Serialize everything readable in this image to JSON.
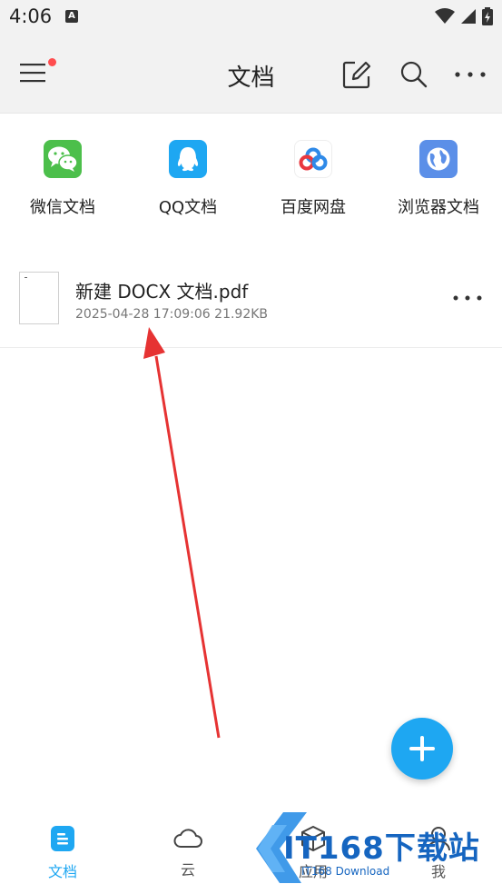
{
  "status_bar": {
    "time": "4:06",
    "a_badge": "A"
  },
  "app_bar": {
    "title": "文档"
  },
  "sources": [
    {
      "label": "微信文档",
      "icon": "wechat-icon",
      "color": "#4cbf4b"
    },
    {
      "label": "QQ文档",
      "icon": "qq-icon",
      "color": "#1ea7f2"
    },
    {
      "label": "百度网盘",
      "icon": "baidu-netdisk-icon",
      "color": "#ffffff"
    },
    {
      "label": "浏览器文档",
      "icon": "browser-icon",
      "color": "#5b8fe8"
    }
  ],
  "files": [
    {
      "name": "新建 DOCX 文档.pdf",
      "date": "2025-04-28 17:09:06",
      "size": "21.92KB"
    }
  ],
  "bottom_nav": [
    {
      "label": "文档",
      "icon": "document-icon",
      "active": true
    },
    {
      "label": "云",
      "icon": "cloud-icon",
      "active": false
    },
    {
      "label": "应用",
      "icon": "app-box-icon",
      "active": false
    },
    {
      "label": "我",
      "icon": "profile-icon",
      "active": false
    }
  ],
  "watermark": {
    "brand": "IT168下载站",
    "subtitle": "IT168 Download"
  },
  "colors": {
    "accent": "#1ea7f2",
    "arrow": "#e63333",
    "notification_dot": "#ff4d4f"
  }
}
